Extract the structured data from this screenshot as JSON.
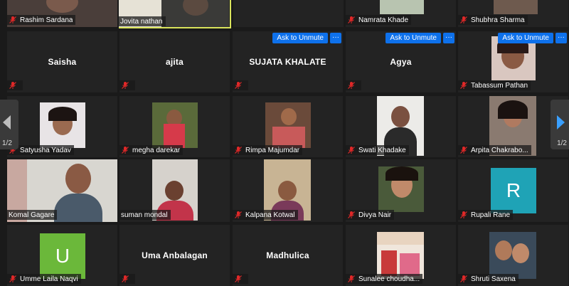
{
  "colors": {
    "accent": "#0e71eb",
    "mute": "#e02828",
    "active_border": "#d9e35b",
    "tile_bg": "#232323"
  },
  "navigation": {
    "page_left": "1/2",
    "page_right": "1/2",
    "left_icon": "chevron-left-icon",
    "right_icon": "chevron-right-icon"
  },
  "controls": {
    "ask_to_unmute": "Ask to Unmute",
    "more": "···"
  },
  "participants": [
    {
      "name": "Rashim Sardana",
      "video": true
    },
    {
      "name": "Jovita nathan",
      "video": true,
      "active": true
    },
    {
      "name": "",
      "video": false
    },
    {
      "name": "Namrata Khade",
      "video": true
    },
    {
      "name": "Shubhra Sharma",
      "video": true
    },
    {
      "name": "Saisha",
      "video": false
    },
    {
      "name": "ajita",
      "video": false
    },
    {
      "name": "SUJATA KHALATE",
      "video": false,
      "ask_to_unmute": true
    },
    {
      "name": "Agya",
      "video": false,
      "ask_to_unmute": true
    },
    {
      "name": "Tabassum Pathan",
      "video": true,
      "ask_to_unmute": true
    },
    {
      "name": "Satyusha Yadav",
      "video": true
    },
    {
      "name": "megha darekar",
      "video": true
    },
    {
      "name": "Rimpa Majumdar",
      "video": true
    },
    {
      "name": "Swati Khadake",
      "video": true
    },
    {
      "name": "Arpita Chakrabo...",
      "video": true
    },
    {
      "name": "Komal Gagare",
      "video": true
    },
    {
      "name": "suman mondal",
      "video": true
    },
    {
      "name": "Kalpana Kotwal",
      "video": true
    },
    {
      "name": "Divya Nair",
      "video": true
    },
    {
      "name": "Rupali Rane",
      "initial": "R",
      "initial_color": "#1fa3b6"
    },
    {
      "name": "Umme Laila Naqvi",
      "initial": "U",
      "initial_color": "#6bb83a"
    },
    {
      "name": "Uma Anbalagan",
      "video": false
    },
    {
      "name": "Madhulica",
      "video": false
    },
    {
      "name": "Sunalee choudha...",
      "video": true
    },
    {
      "name": "Shruti Saxena",
      "video": true
    }
  ]
}
